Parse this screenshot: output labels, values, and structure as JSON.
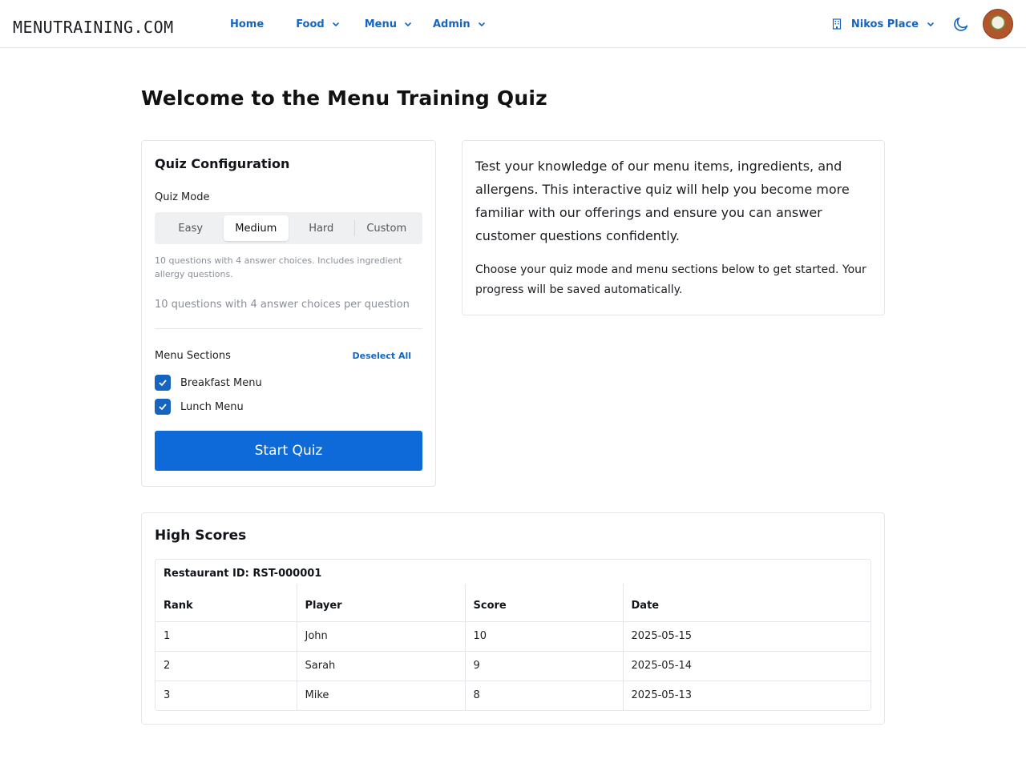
{
  "header": {
    "logo": "MENUTRAINING.COM",
    "nav": [
      {
        "label": "Home",
        "has_menu": false
      },
      {
        "label": "Food",
        "has_menu": true
      },
      {
        "label": "Menu",
        "has_menu": true
      },
      {
        "label": "Admin",
        "has_menu": true
      }
    ],
    "restaurant_label": "Nikos Place",
    "accent_color": "#1565c0"
  },
  "page_title": "Welcome to the Menu Training Quiz",
  "config": {
    "title": "Quiz Configuration",
    "mode_label": "Quiz Mode",
    "modes": [
      "Easy",
      "Medium",
      "Hard",
      "Custom"
    ],
    "selected_mode": "Medium",
    "mode_description": "10 questions with 4 answer choices. Includes ingredient allergy questions.",
    "mode_summary": "10 questions with 4 answer choices per question",
    "sections_label": "Menu Sections",
    "deselect_label": "Deselect All",
    "sections": [
      {
        "label": "Breakfast Menu",
        "checked": true
      },
      {
        "label": "Lunch Menu",
        "checked": true
      }
    ],
    "start_label": "Start Quiz",
    "button_color": "#0d6ad8"
  },
  "intro": {
    "p1": "Test your knowledge of our menu items, ingredients, and allergens. This interactive quiz will help you become more familiar with our offerings and ensure you can answer customer questions confidently.",
    "p2": "Choose your quiz mode and menu sections below to get started. Your progress will be saved automatically."
  },
  "scores": {
    "title": "High Scores",
    "restaurant_id": "Restaurant ID: RST-000001",
    "columns": [
      "Rank",
      "Player",
      "Score",
      "Date"
    ],
    "rows": [
      [
        "1",
        "John",
        "10",
        "2025-05-15"
      ],
      [
        "2",
        "Sarah",
        "9",
        "2025-05-14"
      ],
      [
        "3",
        "Mike",
        "8",
        "2025-05-13"
      ]
    ]
  }
}
